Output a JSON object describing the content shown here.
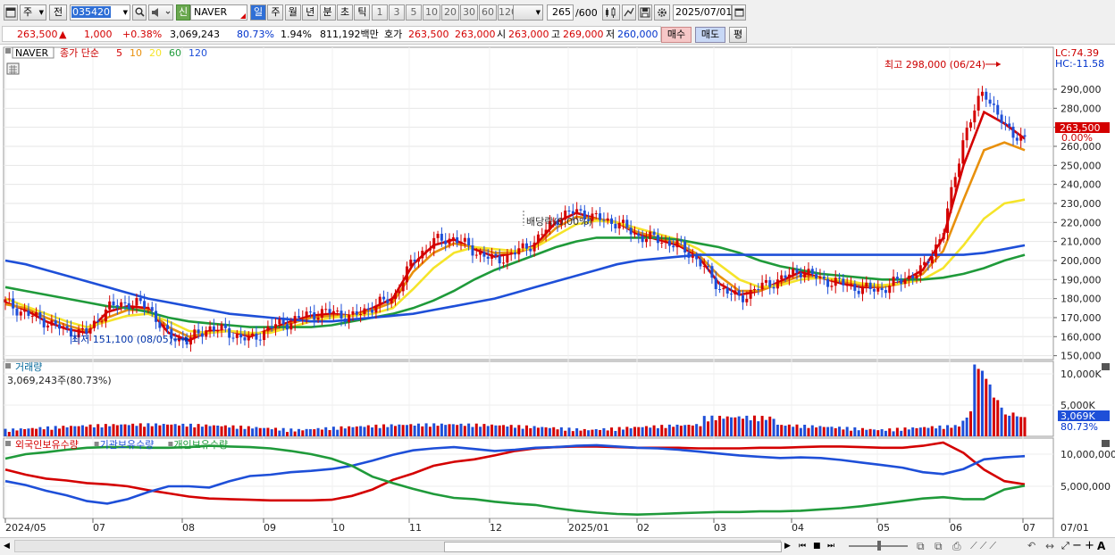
{
  "toolbar": {
    "period_label": "주",
    "prev_label": "전",
    "code": "035420",
    "new_badge": "신",
    "stock_name": "NAVER",
    "periods": [
      "일",
      "주",
      "월",
      "년",
      "분",
      "초",
      "틱"
    ],
    "active_period": "일",
    "intervals": [
      "1",
      "3",
      "5",
      "10",
      "20",
      "30",
      "60",
      "120"
    ],
    "count_value": "265",
    "count_total": "/600",
    "date": "2025/07/01"
  },
  "quote": {
    "price": "263,500",
    "arrow": "▲",
    "change": "1,000",
    "change_pct": "+0.38%",
    "volume": "3,069,243",
    "volume_ratio": "80.73%",
    "turnover_pct": "1.94%",
    "amount": "811,192백만",
    "bid_label": "호가",
    "bid": "263,500",
    "ask": "263,000",
    "open_label": "시",
    "open": "263,000",
    "high_label": "고",
    "high": "269,000",
    "low_label": "저",
    "low": "260,000",
    "buy_label": "매수",
    "sell_label": "매도",
    "eval_label": "평"
  },
  "price_panel": {
    "stock_tag": "NAVER",
    "legend_title": "종가 단순",
    "ma_periods": [
      "5",
      "10",
      "20",
      "60",
      "120"
    ],
    "ma_colors": [
      "#d40000",
      "#e8900c",
      "#f5e42a",
      "#1f9a3a",
      "#1e4fd8"
    ],
    "lc_label": "LC:74.39",
    "hc_label": "HC:-11.58",
    "high_annotation": "최고 298,000 (06/24)",
    "low_annotation": "최저 151,100 (08/05)",
    "rights_annotation": "배당락(0.00%)",
    "current_price_tag": "263,500",
    "current_pct_tag": "0.00%",
    "y_ticks": [
      "290,000",
      "280,000",
      "270,000",
      "260,000",
      "250,000",
      "240,000",
      "230,000",
      "220,000",
      "210,000",
      "200,000",
      "190,000",
      "180,000",
      "170,000",
      "160,000",
      "150,000"
    ]
  },
  "volume_panel": {
    "title": "거래량",
    "value": "3,069,243주(80.73%)",
    "y_ticks": [
      "10,000K",
      "5,000K"
    ],
    "current_tag": "3,069K",
    "current_pct": "80.73%"
  },
  "holdings_panel": {
    "legend": [
      "외국인보유수량",
      "기관보유수량",
      "개인보유수량"
    ],
    "colors": [
      "#d40000",
      "#1e4fd8",
      "#1f9a3a"
    ],
    "y_ticks": [
      "10,000,000",
      "5,000,000"
    ]
  },
  "x_axis": {
    "labels": [
      "2024/05",
      "07",
      "08",
      "09",
      "10",
      "11",
      "12",
      "2025/01",
      "02",
      "03",
      "04",
      "05",
      "06",
      "07"
    ],
    "right_label": "07/01"
  },
  "chart_data": {
    "type": "candlestick",
    "period": "daily",
    "x_start": "2024/05",
    "x_end": "2025/07/01",
    "ylim": [
      145000,
      300000
    ],
    "series": [
      {
        "name": "종가",
        "close_approx": [
          178000,
          172000,
          168000,
          163000,
          162000,
          175000,
          178000,
          176000,
          160000,
          158000,
          165000,
          162000,
          158000,
          165000,
          168000,
          172000,
          173000,
          170000,
          176000,
          180000,
          200000,
          210000,
          212000,
          205000,
          200000,
          204000,
          210000,
          222000,
          226000,
          222000,
          220000,
          213000,
          211000,
          208000,
          200000,
          186000,
          180000,
          186000,
          190000,
          195000,
          190000,
          188000,
          185000,
          185000,
          190000,
          195000,
          215000,
          265000,
          290000,
          270000,
          263500
        ]
      },
      {
        "name": "5",
        "values": [
          178000,
          174000,
          168000,
          164000,
          162000,
          173000,
          176000,
          175000,
          162000,
          158000,
          163000,
          163000,
          160000,
          164000,
          168000,
          171000,
          172000,
          171000,
          175000,
          180000,
          198000,
          208000,
          211000,
          206000,
          202000,
          204000,
          208000,
          220000,
          225000,
          222000,
          220000,
          214000,
          211000,
          208000,
          202000,
          188000,
          182000,
          184000,
          189000,
          194000,
          191000,
          188000,
          186000,
          186000,
          189000,
          195000,
          212000,
          250000,
          278000,
          272000,
          264000
        ]
      },
      {
        "name": "10",
        "values": [
          177000,
          175000,
          170000,
          166000,
          163000,
          170000,
          174000,
          174000,
          165000,
          160000,
          162000,
          163000,
          161000,
          163000,
          167000,
          170000,
          171000,
          171000,
          174000,
          178000,
          194000,
          204000,
          209000,
          207000,
          204000,
          204000,
          207000,
          217000,
          223000,
          222000,
          220000,
          215000,
          212000,
          209000,
          203000,
          192000,
          184000,
          184000,
          188000,
          192000,
          191000,
          189000,
          187000,
          186000,
          188000,
          193000,
          205000,
          232000,
          258000,
          262000,
          258000
        ]
      },
      {
        "name": "20",
        "values": [
          180000,
          176000,
          172000,
          168000,
          165000,
          168000,
          171000,
          172000,
          168000,
          163000,
          162000,
          163000,
          162000,
          162000,
          165000,
          168000,
          170000,
          171000,
          172000,
          175000,
          185000,
          196000,
          204000,
          207000,
          206000,
          205000,
          207000,
          213000,
          219000,
          221000,
          220000,
          217000,
          214000,
          211000,
          206000,
          198000,
          190000,
          186000,
          187000,
          190000,
          191000,
          190000,
          188000,
          187000,
          188000,
          190000,
          196000,
          208000,
          222000,
          230000,
          232000
        ]
      },
      {
        "name": "60",
        "values": [
          186000,
          184000,
          182000,
          180000,
          178000,
          176000,
          175000,
          173000,
          170000,
          168000,
          167000,
          166000,
          165000,
          165000,
          165000,
          165000,
          166000,
          168000,
          170000,
          172000,
          175000,
          179000,
          184000,
          190000,
          195000,
          199000,
          203000,
          207000,
          210000,
          212000,
          212000,
          212000,
          212000,
          211000,
          209000,
          207000,
          204000,
          200000,
          197000,
          195000,
          193000,
          192000,
          191000,
          190000,
          190000,
          190000,
          191000,
          193000,
          196000,
          200000,
          203000
        ]
      },
      {
        "name": "120",
        "values": [
          200000,
          198000,
          195000,
          192000,
          189000,
          186000,
          183000,
          180000,
          178000,
          176000,
          174000,
          172000,
          171000,
          170000,
          169000,
          168000,
          168000,
          169000,
          170000,
          171000,
          172000,
          174000,
          176000,
          178000,
          180000,
          183000,
          186000,
          189000,
          192000,
          195000,
          198000,
          200000,
          201000,
          202000,
          203000,
          203000,
          203000,
          203000,
          203000,
          203000,
          203000,
          203000,
          203000,
          203000,
          203000,
          203000,
          203000,
          203000,
          204000,
          206000,
          208000
        ]
      }
    ],
    "volume": {
      "ylim": [
        0,
        12000000
      ],
      "unit": "shares"
    },
    "holdings": {
      "ylim": [
        0,
        12500000
      ]
    }
  }
}
